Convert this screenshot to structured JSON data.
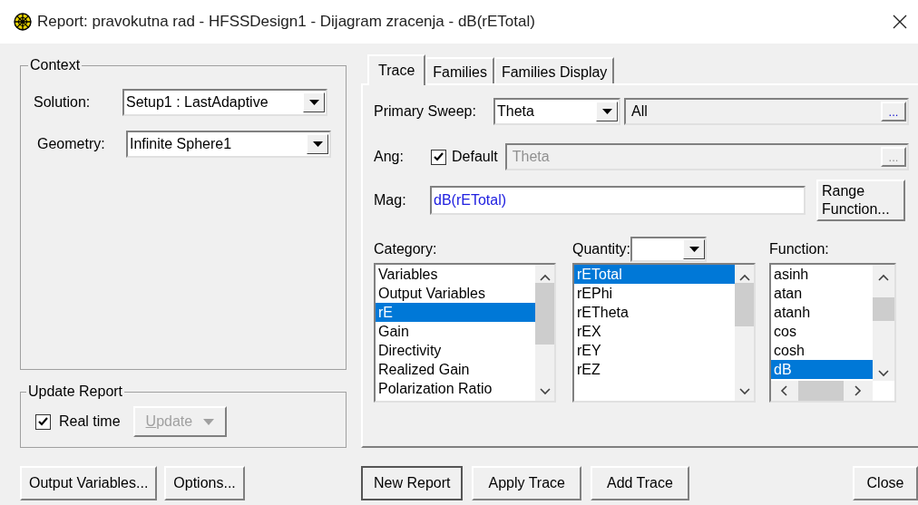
{
  "window": {
    "title": "Report: pravokutna rad - HFSSDesign1 - Dijagram zracenja - dB(rETotal)"
  },
  "context": {
    "title": "Context",
    "fields": [
      {
        "label": "Solution:",
        "value": "Setup1 : LastAdaptive"
      },
      {
        "label": "Geometry:",
        "value": "Infinite Sphere1"
      }
    ]
  },
  "update_report": {
    "title": "Update Report",
    "real_time": {
      "label": "Real time",
      "checked": true
    },
    "update_button": {
      "label": "Update",
      "disabled": true
    }
  },
  "left_buttons": [
    "Output Variables...",
    "Options..."
  ],
  "tabs": [
    {
      "label": "Trace",
      "selected": true
    },
    {
      "label": "Families",
      "selected": false
    },
    {
      "label": "Families Display",
      "selected": false
    }
  ],
  "trace": {
    "primary_sweep": {
      "label": "Primary Sweep:",
      "value": "Theta",
      "range": "All",
      "browse": "..."
    },
    "ang": {
      "label": "Ang:",
      "default_label": "Default",
      "default_checked": true,
      "value": "Theta",
      "browse": "...",
      "disabled": true
    },
    "mag": {
      "label": "Mag:",
      "value": "dB(rETotal)"
    },
    "range_function_button": "Range Function...",
    "category": {
      "label": "Category:",
      "items": [
        {
          "label": "Variables",
          "selected": false
        },
        {
          "label": "Output Variables",
          "selected": false
        },
        {
          "label": "rE",
          "selected": true
        },
        {
          "label": "Gain",
          "selected": false
        },
        {
          "label": "Directivity",
          "selected": false
        },
        {
          "label": "Realized Gain",
          "selected": false
        },
        {
          "label": "Polarization Ratio",
          "selected": false
        }
      ]
    },
    "quantity": {
      "label": "Quantity:",
      "items": [
        {
          "label": "rETotal",
          "selected": true
        },
        {
          "label": "rEPhi",
          "selected": false
        },
        {
          "label": "rETheta",
          "selected": false
        },
        {
          "label": "rEX",
          "selected": false
        },
        {
          "label": "rEY",
          "selected": false
        },
        {
          "label": "rEZ",
          "selected": false
        }
      ]
    },
    "function": {
      "label": "Function:",
      "items": [
        {
          "label": "asinh",
          "selected": false
        },
        {
          "label": "atan",
          "selected": false
        },
        {
          "label": "atanh",
          "selected": false
        },
        {
          "label": "cos",
          "selected": false
        },
        {
          "label": "cosh",
          "selected": false
        },
        {
          "label": "dB",
          "selected": true
        }
      ]
    }
  },
  "bottom_buttons": [
    {
      "label": "New Report",
      "default": true
    },
    {
      "label": "Apply Trace",
      "default": false
    },
    {
      "label": "Add Trace",
      "default": false
    }
  ],
  "close_button": "Close"
}
